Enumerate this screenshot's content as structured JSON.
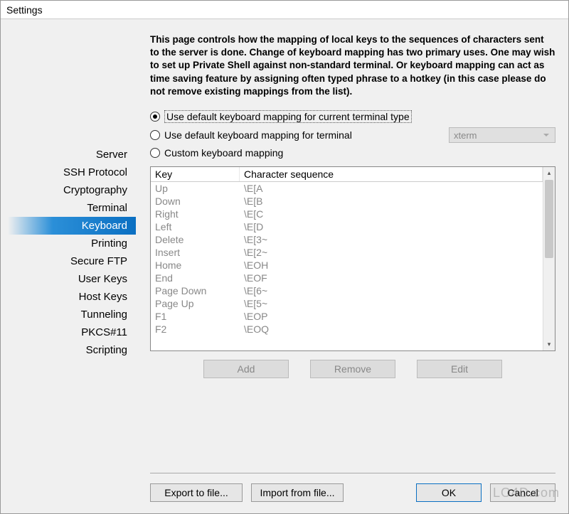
{
  "window": {
    "title": "Settings"
  },
  "sidebar": {
    "items": [
      {
        "label": "Server"
      },
      {
        "label": "SSH Protocol"
      },
      {
        "label": "Cryptography"
      },
      {
        "label": "Terminal"
      },
      {
        "label": "Keyboard"
      },
      {
        "label": "Printing"
      },
      {
        "label": "Secure FTP"
      },
      {
        "label": "User Keys"
      },
      {
        "label": "Host Keys"
      },
      {
        "label": "Tunneling"
      },
      {
        "label": "PKCS#11"
      },
      {
        "label": "Scripting"
      }
    ],
    "active_index": 4
  },
  "description": "This page controls how the mapping of local keys to the sequences of characters sent to the server is done. Change of keyboard mapping has two primary uses. One may wish to set up Private Shell against non-standard terminal. Or keyboard mapping can act as time saving feature by assigning often typed phrase to a hotkey (in this case please do not remove existing mappings from the list).",
  "radios": {
    "opt1": "Use default keyboard mapping for current terminal type",
    "opt2": "Use default keyboard mapping for terminal",
    "opt3": "Custom keyboard mapping",
    "selected": 0,
    "terminal_combo": "xterm"
  },
  "table": {
    "headers": {
      "key": "Key",
      "seq": "Character sequence"
    },
    "rows": [
      {
        "key": "Up",
        "seq": "\\E[A"
      },
      {
        "key": "Down",
        "seq": "\\E[B"
      },
      {
        "key": "Right",
        "seq": "\\E[C"
      },
      {
        "key": "Left",
        "seq": "\\E[D"
      },
      {
        "key": "Delete",
        "seq": "\\E[3~"
      },
      {
        "key": "Insert",
        "seq": "\\E[2~"
      },
      {
        "key": "Home",
        "seq": "\\EOH"
      },
      {
        "key": "End",
        "seq": "\\EOF"
      },
      {
        "key": "Page Down",
        "seq": "\\E[6~"
      },
      {
        "key": "Page Up",
        "seq": "\\E[5~"
      },
      {
        "key": "F1",
        "seq": "\\EOP"
      },
      {
        "key": "F2",
        "seq": "\\EOQ"
      }
    ]
  },
  "buttons": {
    "add": "Add",
    "remove": "Remove",
    "edit": "Edit",
    "export": "Export to file...",
    "import": "Import from file...",
    "ok": "OK",
    "cancel": "Cancel"
  },
  "watermark": "LO4D.com"
}
